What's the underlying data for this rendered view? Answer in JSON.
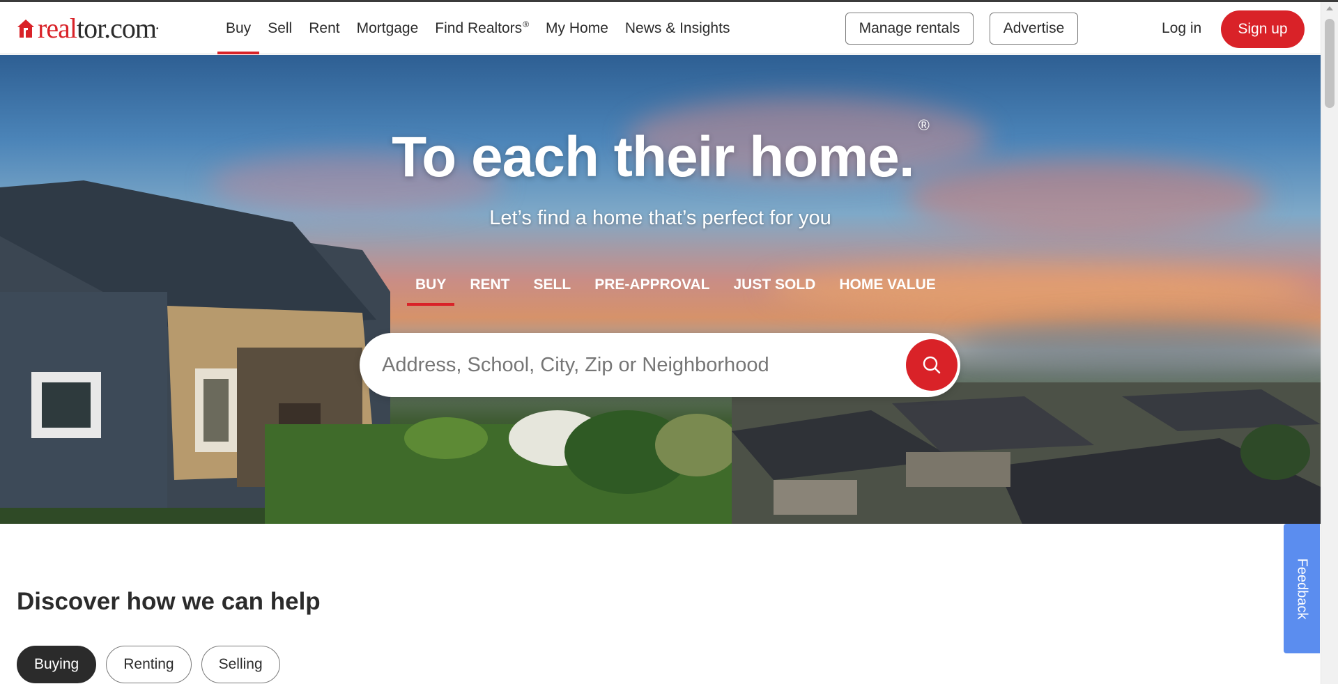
{
  "brand": {
    "logo_red": "real",
    "logo_dark": "tor.com",
    "accent_color": "#d92228"
  },
  "nav": {
    "items": [
      {
        "label": "Buy",
        "active": true
      },
      {
        "label": "Sell"
      },
      {
        "label": "Rent"
      },
      {
        "label": "Mortgage"
      },
      {
        "label": "Find Realtors",
        "sup": "®"
      },
      {
        "label": "My Home"
      },
      {
        "label": "News & Insights"
      }
    ]
  },
  "header_actions": {
    "manage_rentals": "Manage rentals",
    "advertise": "Advertise",
    "login": "Log in",
    "signup": "Sign up"
  },
  "hero": {
    "title": "To each their home.",
    "title_mark": "®",
    "subtitle": "Let’s find a home that’s perfect for you",
    "tabs": [
      "BUY",
      "RENT",
      "SELL",
      "PRE-APPROVAL",
      "JUST SOLD",
      "HOME VALUE"
    ],
    "active_tab": "BUY",
    "search_placeholder": "Address, School, City, Zip or Neighborhood",
    "search_icon": "search-icon"
  },
  "discover": {
    "title": "Discover how we can help",
    "pills": [
      "Buying",
      "Renting",
      "Selling"
    ],
    "active_pill": "Buying"
  },
  "feedback": {
    "label": "Feedback",
    "color": "#5b8def"
  }
}
